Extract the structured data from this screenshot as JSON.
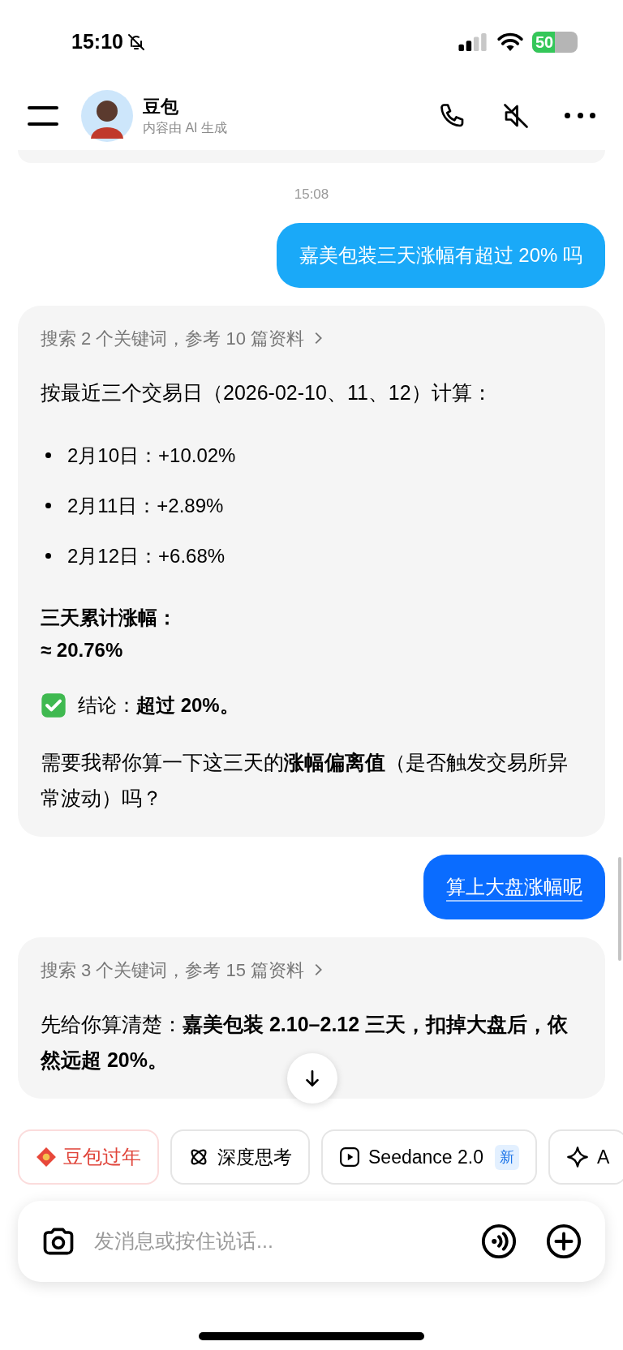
{
  "status_bar": {
    "time": "15:10",
    "battery": "50"
  },
  "header": {
    "name": "豆包",
    "subtitle": "内容由 AI 生成"
  },
  "messages": [
    {
      "kind": "time",
      "text": "15:08"
    },
    {
      "kind": "user",
      "text": "嘉美包装三天涨幅有超过 20% 吗",
      "highlighted": false
    },
    {
      "kind": "bot",
      "sources": "搜索 2 个关键词，参考 10 篇资料",
      "blocks": [
        {
          "kind": "text",
          "text": "按最近三个交易日（2026-02-10、11、12）计算："
        },
        {
          "kind": "bullets",
          "items": [
            "2月10日：+10.02%",
            "2月11日：+2.89%",
            "2月12日：+6.68%"
          ]
        },
        {
          "kind": "bold",
          "lines": [
            "三天累计涨幅：",
            "≈ 20.76%"
          ]
        },
        {
          "kind": "check",
          "text": "结论：**超过 20%。**"
        },
        {
          "kind": "text",
          "text": "需要我帮你算一下这三天的**涨幅偏离值**（是否触发交易所异常波动）吗？"
        }
      ]
    },
    {
      "kind": "user",
      "text": "算上大盘涨幅呢",
      "highlighted": true
    },
    {
      "kind": "bot",
      "sources": "搜索 3 个关键词，参考 15 篇资料",
      "blocks": [
        {
          "kind": "text",
          "text": "先给你算清楚：**嘉美包装 2.10–2.12 三天，扣掉大盘后，依然远超 20%。**"
        }
      ]
    }
  ],
  "chips": [
    {
      "kind": "festival",
      "label": "豆包过年"
    },
    {
      "kind": "think",
      "label": "深度思考"
    },
    {
      "kind": "video",
      "label": "Seedance 2.0",
      "badge": "新"
    },
    {
      "kind": "spark",
      "label": "A"
    }
  ],
  "input": {
    "placeholder": "发消息或按住说话..."
  }
}
